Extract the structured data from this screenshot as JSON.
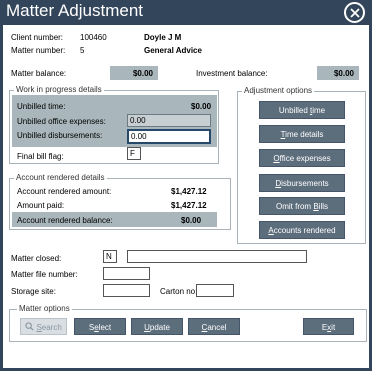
{
  "window": {
    "title": "Matter Adjustment"
  },
  "header": {
    "client_number_label": "Client number:",
    "client_number": "100460",
    "client_name": "Doyle J M",
    "matter_number_label": "Matter number:",
    "matter_number": "5",
    "matter_name": "General Advice",
    "matter_balance_label": "Matter balance:",
    "matter_balance": "$0.00",
    "investment_balance_label": "Investment balance:",
    "investment_balance": "$0.00"
  },
  "wip": {
    "group_label": "Work in progress details",
    "unbilled_time_label": "Unbilled time:",
    "unbilled_time": "$0.00",
    "unbilled_office_label": "Unbilled office expenses:",
    "unbilled_office": "0.00",
    "unbilled_disb_label": "Unbilled disbursements:",
    "unbilled_disb": "0.00",
    "final_bill_label": "Final bill flag:",
    "final_bill": "F"
  },
  "account": {
    "group_label": "Account rendered details",
    "rendered_amount_label": "Account rendered amount:",
    "rendered_amount": "$1,427.12",
    "amount_paid_label": "Amount paid:",
    "amount_paid": "$1,427.12",
    "rendered_balance_label": "Account rendered balance:",
    "rendered_balance": "$0.00"
  },
  "adjustment": {
    "group_label": "Adjustment options",
    "buttons": [
      {
        "pre": "Unbilled ",
        "ul": "t",
        "post": "ime"
      },
      {
        "pre": "",
        "ul": "T",
        "post": "ime details"
      },
      {
        "pre": "",
        "ul": "O",
        "post": "ffice expenses"
      },
      {
        "pre": "",
        "ul": "D",
        "post": "isbursements"
      },
      {
        "pre": "Omit from ",
        "ul": "B",
        "post": "ills"
      },
      {
        "pre": "",
        "ul": "A",
        "post": "ccounts rendered"
      }
    ]
  },
  "details": {
    "matter_closed_label": "Matter closed:",
    "matter_closed": "N",
    "matter_closed_note": "",
    "file_number_label": "Matter file number:",
    "file_number": "",
    "storage_site_label": "Storage site:",
    "storage_site": "",
    "carton_label": "Carton no:",
    "carton": ""
  },
  "matter_options": {
    "group_label": "Matter options",
    "search": {
      "ul": "S",
      "post": "earch"
    },
    "select": {
      "pre": "S",
      "ul": "e",
      "post": "lect"
    },
    "update": {
      "ul": "U",
      "post": "pdate"
    },
    "cancel": {
      "ul": "C",
      "post": "ancel"
    },
    "exit": {
      "pre": "E",
      "ul": "x",
      "post": "it"
    }
  }
}
